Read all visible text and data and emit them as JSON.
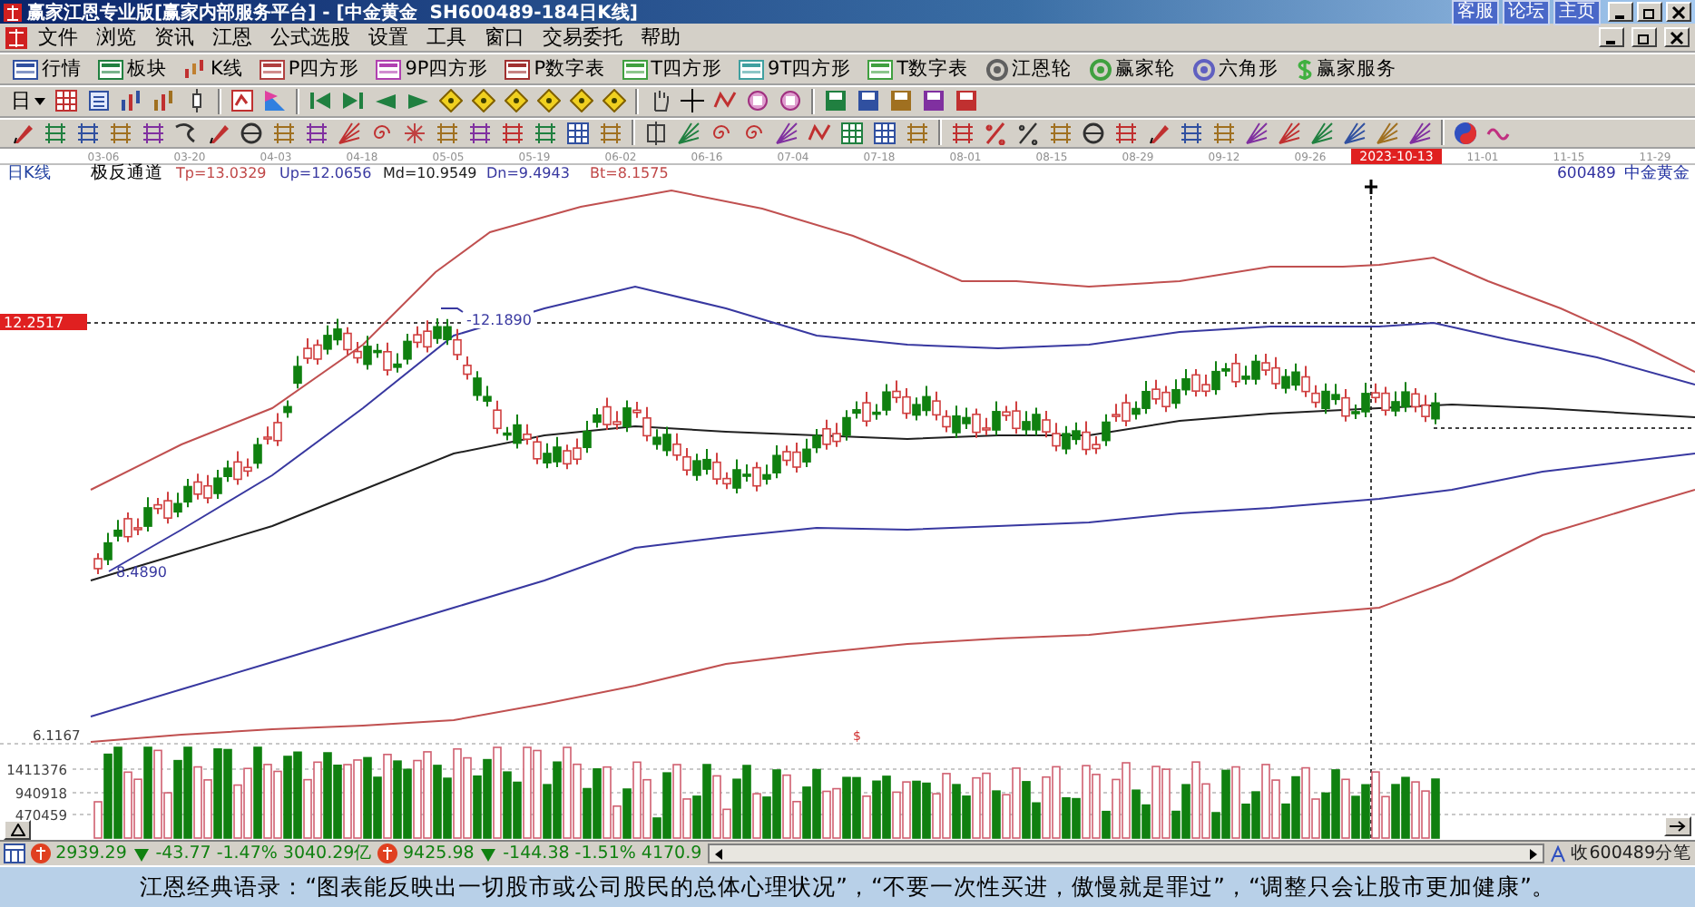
{
  "window": {
    "title": "赢家江恩专业版[赢家内部服务平台] - [中金黄金  SH600489-184日K线]",
    "title_links": [
      "客服",
      "论坛",
      "主页"
    ]
  },
  "menu": [
    "文件",
    "浏览",
    "资讯",
    "江恩",
    "公式选股",
    "设置",
    "工具",
    "窗口",
    "交易委托",
    "帮助"
  ],
  "main_toolbar": [
    "行情",
    "板块",
    "K线",
    "P四方形",
    "9P四方形",
    "P数字表",
    "T四方形",
    "9T四方形",
    "T数字表",
    "江恩轮",
    "赢家轮",
    "六角形",
    "赢家服务"
  ],
  "period_selector": {
    "value": "日"
  },
  "chart": {
    "period_label": "日K线",
    "dates": [
      {
        "label": "03-06",
        "selected": false
      },
      {
        "label": "03-20",
        "selected": false
      },
      {
        "label": "04-03",
        "selected": false
      },
      {
        "label": "04-18",
        "selected": false
      },
      {
        "label": "05-05",
        "selected": false
      },
      {
        "label": "05-19",
        "selected": false
      },
      {
        "label": "06-02",
        "selected": false
      },
      {
        "label": "06-16",
        "selected": false
      },
      {
        "label": "07-04",
        "selected": false
      },
      {
        "label": "07-18",
        "selected": false
      },
      {
        "label": "08-01",
        "selected": false
      },
      {
        "label": "08-15",
        "selected": false
      },
      {
        "label": "08-29",
        "selected": false
      },
      {
        "label": "09-12",
        "selected": false
      },
      {
        "label": "09-26",
        "selected": false
      },
      {
        "label": "2023-10-13",
        "selected": true
      },
      {
        "label": "11-01",
        "selected": false
      },
      {
        "label": "11-15",
        "selected": false
      },
      {
        "label": "11-29",
        "selected": false
      }
    ],
    "indicator": {
      "name": "极反通道",
      "values": [
        {
          "text": "Tp=13.0329",
          "color": "#c04848"
        },
        {
          "text": "Up=12.0656",
          "color": "#3838a0"
        },
        {
          "text": "Md=10.9549",
          "color": "#202020"
        },
        {
          "text": "Dn=9.4943",
          "color": "#3838a0"
        },
        {
          "text": "Bt=8.1575",
          "color": "#c04848"
        }
      ]
    },
    "stock": {
      "code": "600489",
      "name": "中金黄金"
    },
    "crosshair_price": "12.2517",
    "peak_label": "-12.1890",
    "low_label": "8.4890",
    "indicator_axis": "6.1167",
    "marker": "$",
    "volume_ticks": [
      "1411376",
      "940918",
      "470459"
    ]
  },
  "status_bar": {
    "indices": [
      {
        "value": "2939.29",
        "change": "-43.77",
        "percent": "-1.47%",
        "amount": "3040.29亿"
      },
      {
        "value": "9425.98",
        "change": "-144.38",
        "percent": "-1.51%",
        "amount": "4170.9"
      }
    ],
    "tick_label": "收600489分笔"
  },
  "quote": "江恩经典语录：“图表能反映出一切股市或公司股民的总体心理状况”，“不要一次性买进，傲慢就是罪过”，“调整只会让股市更加健康”。"
}
